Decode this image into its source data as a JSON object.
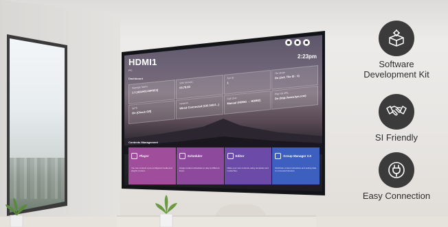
{
  "tv": {
    "title": "HDMI1",
    "subtitle": "PC",
    "time": "2:23pm",
    "section_dashboard": "Dashboard",
    "info": [
      {
        "label": "Signage Name",
        "value": "1.1 [43UH5J-BP8C3]"
      },
      {
        "label": "S/W Version",
        "value": "03.78.80"
      },
      {
        "label": "Set ID",
        "value": "1"
      },
      {
        "label": "Tile Mode",
        "value": "On (2x2, Tile ID : 1)"
      },
      {
        "label": "SIPS",
        "value": "On (Check Off)"
      },
      {
        "label": "Network",
        "value": "Wired Connected (192.168.0...)"
      },
      {
        "label": "Fail Over",
        "value": "Manual (HDMI1 → HDMI2)"
      },
      {
        "label": "Play via URL",
        "value": "On (http://www.lge.com)"
      }
    ],
    "section_contents": "Contents Management",
    "tiles": [
      {
        "name": "Player",
        "desc": "You can connect a pre-configured media and playlist content.",
        "color": "#a04d9b"
      },
      {
        "name": "Scheduler",
        "desc": "Assign content schedules to play at different times.",
        "color": "#8d4a9c"
      },
      {
        "name": "Editor",
        "desc": "Make your own contents using templates and media files.",
        "color": "#6b4aa8"
      },
      {
        "name": "Group Manager 2.0",
        "desc": "Distribute content schedules and setting data to connected devices.",
        "color": "#3d5fc0"
      }
    ]
  },
  "features": [
    {
      "label": "Software Development Kit",
      "icon": "box-gear-icon"
    },
    {
      "label": "SI Friendly",
      "icon": "handshake-icon"
    },
    {
      "label": "Easy Connection",
      "icon": "power-plug-icon"
    }
  ]
}
